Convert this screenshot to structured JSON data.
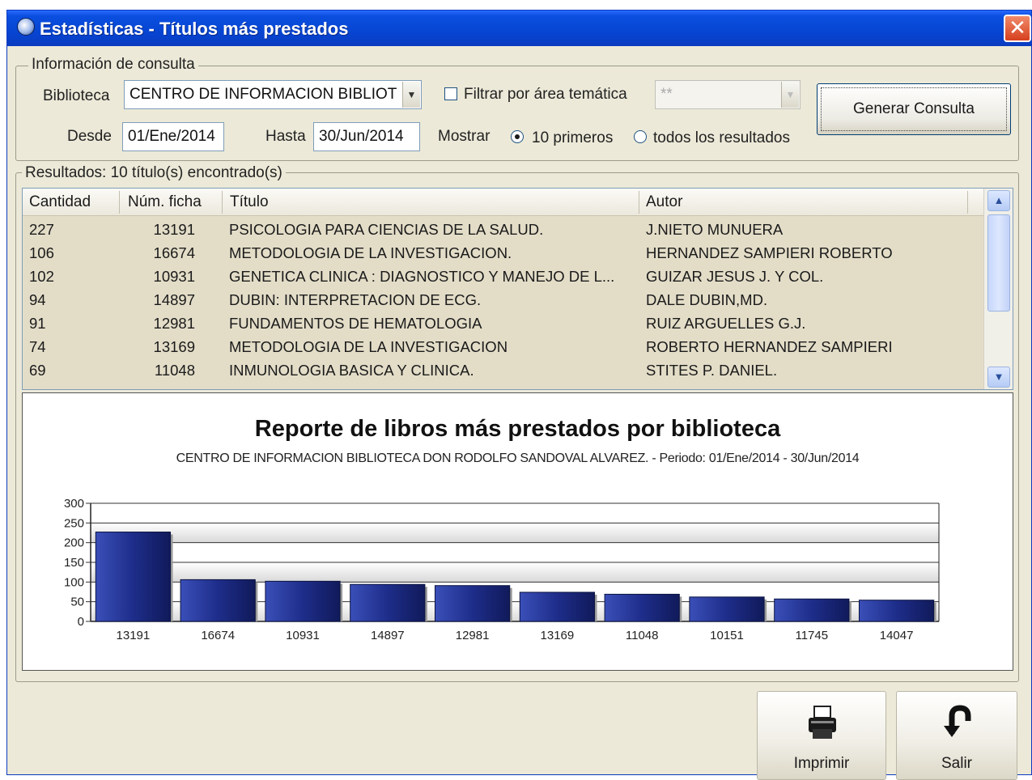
{
  "window": {
    "title": "Estadísticas - Títulos más prestados",
    "close_glyph": "✕"
  },
  "query": {
    "group_label": "Información de consulta",
    "biblioteca_label": "Biblioteca",
    "biblioteca_value": "CENTRO DE INFORMACION BIBLIOT",
    "filter_label": "Filtrar por área temática",
    "filter_checked": false,
    "area_value": "**",
    "desde_label": "Desde",
    "desde_value": "01/Ene/2014",
    "hasta_label": "Hasta",
    "hasta_value": "30/Jun/2014",
    "mostrar_label": "Mostrar",
    "option_top": "10 primeros",
    "option_all": "todos los resultados",
    "selected_option": "10 primeros",
    "generate_button": "Generar Consulta"
  },
  "results": {
    "group_label": "Resultados: 10 título(s) encontrado(s)",
    "columns": [
      "Cantidad",
      "Núm. ficha",
      "Título",
      "Autor"
    ],
    "rows": [
      {
        "cantidad": "227",
        "ficha": "13191",
        "titulo": "PSICOLOGIA PARA CIENCIAS DE LA SALUD.",
        "autor": "J.NIETO  MUNUERA"
      },
      {
        "cantidad": "106",
        "ficha": "16674",
        "titulo": "METODOLOGIA DE LA INVESTIGACION.",
        "autor": "HERNANDEZ SAMPIERI ROBERTO"
      },
      {
        "cantidad": "102",
        "ficha": "10931",
        "titulo": "GENETICA CLINICA : DIAGNOSTICO Y MANEJO DE L...",
        "autor": "GUIZAR JESUS J. Y COL."
      },
      {
        "cantidad": "94",
        "ficha": "14897",
        "titulo": "DUBIN: INTERPRETACION DE ECG.",
        "autor": "DALE DUBIN,MD."
      },
      {
        "cantidad": "91",
        "ficha": "12981",
        "titulo": "FUNDAMENTOS DE HEMATOLOGIA",
        "autor": "RUIZ ARGUELLES  G.J."
      },
      {
        "cantidad": "74",
        "ficha": "13169",
        "titulo": "METODOLOGIA DE LA INVESTIGACION",
        "autor": "ROBERTO  HERNANDEZ SAMPIERI"
      },
      {
        "cantidad": "69",
        "ficha": "11048",
        "titulo": "INMUNOLOGIA BASICA Y CLINICA.",
        "autor": "STITES P. DANIEL."
      }
    ]
  },
  "chart_data": {
    "type": "bar",
    "title": "Reporte de libros más prestados por biblioteca",
    "subtitle": "CENTRO DE INFORMACION BIBLIOTECA DON RODOLFO SANDOVAL ALVAREZ. - Periodo: 01/Ene/2014 - 30/Jun/2014",
    "categories": [
      "13191",
      "16674",
      "10931",
      "14897",
      "12981",
      "13169",
      "11048",
      "10151",
      "11745",
      "14047"
    ],
    "values": [
      227,
      106,
      102,
      94,
      91,
      74,
      69,
      62,
      57,
      54
    ],
    "ylim": [
      0,
      300
    ],
    "yticks": [
      0,
      50,
      100,
      150,
      200,
      250,
      300
    ],
    "grid": true,
    "bar_color": "#1f2f8f"
  },
  "footer": {
    "print_label": "Imprimir",
    "exit_label": "Salir"
  }
}
